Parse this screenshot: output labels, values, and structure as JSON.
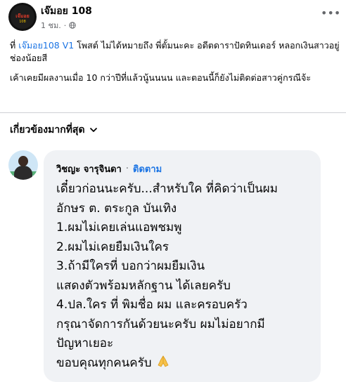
{
  "post": {
    "page_name": "เจ๊มอย 108",
    "time": "1 ชม.",
    "avatar_text": "เจ๊มอย",
    "avatar_sub": "108",
    "caption_line1_prefix": "ที่ ",
    "caption_mention": "เจ๊มอย108 V1",
    "caption_line1_suffix": " โพสต์ ไม่ได้หมายถึง พี่ตั้มนะคะ อดีตดาราปัดทินเดอร์ หลอกเงินสาวอยู่ช่องน้อยสี",
    "caption_line2": "เค้าเคยมีผลงานเมื่อ 10 กว่าปีที่แล้วนู้นนนน และตอนนี้ก็ยังไม่ติดต่อสาวคู่กรณีจ้ะ"
  },
  "comments": {
    "sort_label": "เกี่ยวข้องมากที่สุด",
    "items": [
      {
        "author": "วิชญะ จารุจินดา",
        "follow_label": "ติดตาม",
        "text": "เดี๋ยวก่อนนะครับ...สำหรับใค ที่คิดว่าเป็นผม\nอักษร ต. ตระกูล บันเทิง\n1.ผมไม่เคยเล่นแอพชมพู\n2.ผมไม่เคยยืมเงินใคร\n3.ถ้ามีใครที่ บอกว่าผมยืมเงิน\nแสดงตัวพร้อมหลักฐาน ได้เลยครับ\n4.ปล.ใคร ที่ พิมชื่อ ผม และครอบครัว\nกรุณาจัดการกันด้วยนะครับ ผมไม่อยากมี\nปัญหาเยอะ",
        "closing": "ขอบคุณทุกคนครับ"
      }
    ]
  },
  "icons": {
    "globe": "globe-icon",
    "more": "more-icon",
    "chevron": "chevron-down-icon",
    "pray": "pray-icon"
  },
  "colors": {
    "link": "#1b74e4",
    "bubble": "#f0f2f5",
    "secondary": "#65676b"
  }
}
